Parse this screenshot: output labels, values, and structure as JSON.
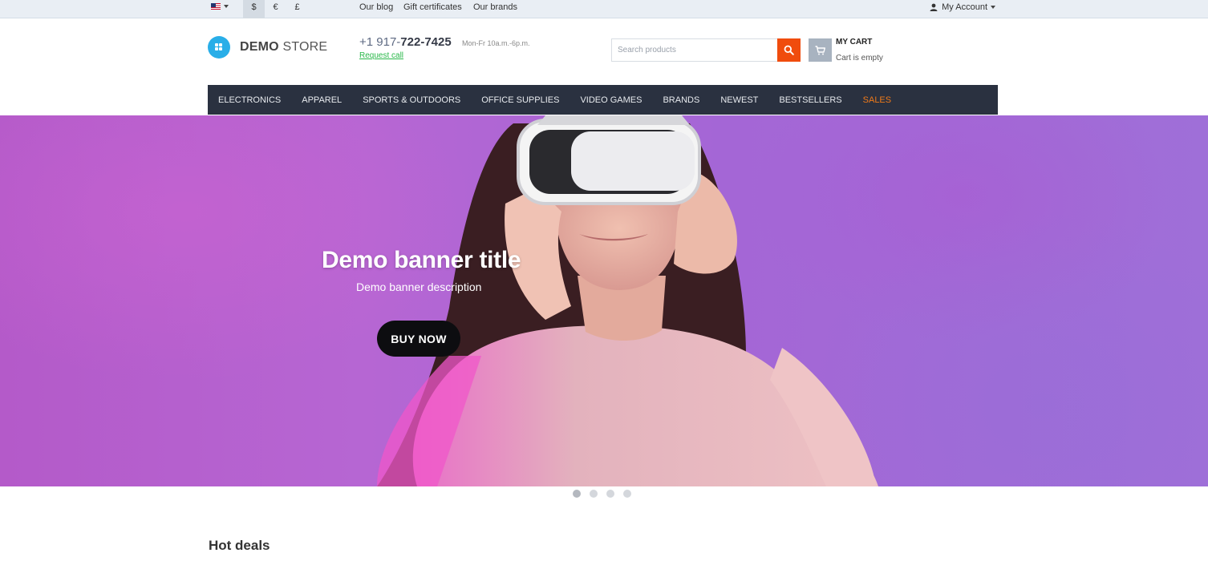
{
  "topbar": {
    "language_icon": "us-flag-icon",
    "currencies": [
      "$",
      "€",
      "£"
    ],
    "active_currency": "$",
    "links": [
      "Our blog",
      "Gift certificates",
      "Our brands"
    ],
    "account_label": "My Account"
  },
  "header": {
    "logo_bold": "DEMO",
    "logo_light": " STORE",
    "phone_prefix": "+1 917-",
    "phone_main": "722-7425",
    "hours": "Mon-Fr 10a.m.-6p.m.",
    "request_call": "Request call",
    "search_placeholder": "Search products",
    "cart_title": "MY CART",
    "cart_status": "Cart is empty"
  },
  "nav": {
    "items": [
      "ELECTRONICS",
      "APPAREL",
      "SPORTS & OUTDOORS",
      "OFFICE SUPPLIES",
      "VIDEO GAMES",
      "BRANDS",
      "NEWEST",
      "BESTSELLERS",
      "SALES"
    ]
  },
  "banner": {
    "title": "Demo banner title",
    "description": "Demo banner description",
    "button": "BUY NOW",
    "slide_count": 4,
    "active_slide": 1
  },
  "sections": {
    "hot_deals": "Hot deals"
  },
  "colors": {
    "accent_orange": "#f04c0d",
    "nav_bg": "#2a3140",
    "sales": "#f07a19",
    "logo_blue": "#29aee8",
    "link_green": "#2ab84a"
  }
}
